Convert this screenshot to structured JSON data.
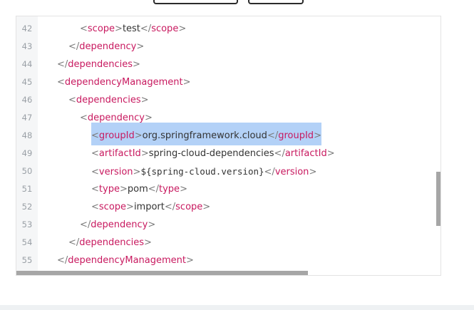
{
  "code_view": {
    "lines": [
      {
        "num": "42",
        "indent": 3,
        "kind": "element",
        "open": "scope",
        "text": "test",
        "close": "scope"
      },
      {
        "num": "43",
        "indent": 2,
        "kind": "close",
        "close": "dependency"
      },
      {
        "num": "44",
        "indent": 1,
        "kind": "close",
        "close": "dependencies"
      },
      {
        "num": "45",
        "indent": 1,
        "kind": "open",
        "open": "dependencyManagement"
      },
      {
        "num": "46",
        "indent": 2,
        "kind": "open",
        "open": "dependencies"
      },
      {
        "num": "47",
        "indent": 3,
        "kind": "open",
        "open": "dependency"
      },
      {
        "num": "48",
        "indent": 4,
        "kind": "element",
        "open": "groupId",
        "text": "org.springframework.cloud",
        "close": "groupId",
        "highlighted": true
      },
      {
        "num": "49",
        "indent": 4,
        "kind": "element",
        "open": "artifactId",
        "text": "spring-cloud-dependencies",
        "close": "artifactId"
      },
      {
        "num": "50",
        "indent": 4,
        "kind": "element",
        "open": "version",
        "text": "${spring-cloud.version}",
        "close": "version",
        "mono": true
      },
      {
        "num": "51",
        "indent": 4,
        "kind": "element",
        "open": "type",
        "text": "pom",
        "close": "type"
      },
      {
        "num": "52",
        "indent": 4,
        "kind": "element",
        "open": "scope",
        "text": "import",
        "close": "scope"
      },
      {
        "num": "53",
        "indent": 3,
        "kind": "close",
        "close": "dependency"
      },
      {
        "num": "54",
        "indent": 2,
        "kind": "close",
        "close": "dependencies"
      },
      {
        "num": "55",
        "indent": 1,
        "kind": "close",
        "close": "dependencyManagement"
      }
    ],
    "colors": {
      "tag": "#c8195f",
      "bracket": "#7a7a7a",
      "text": "#333333",
      "selection": "#b3d1f7",
      "gutter": "#f5f6f7"
    }
  }
}
